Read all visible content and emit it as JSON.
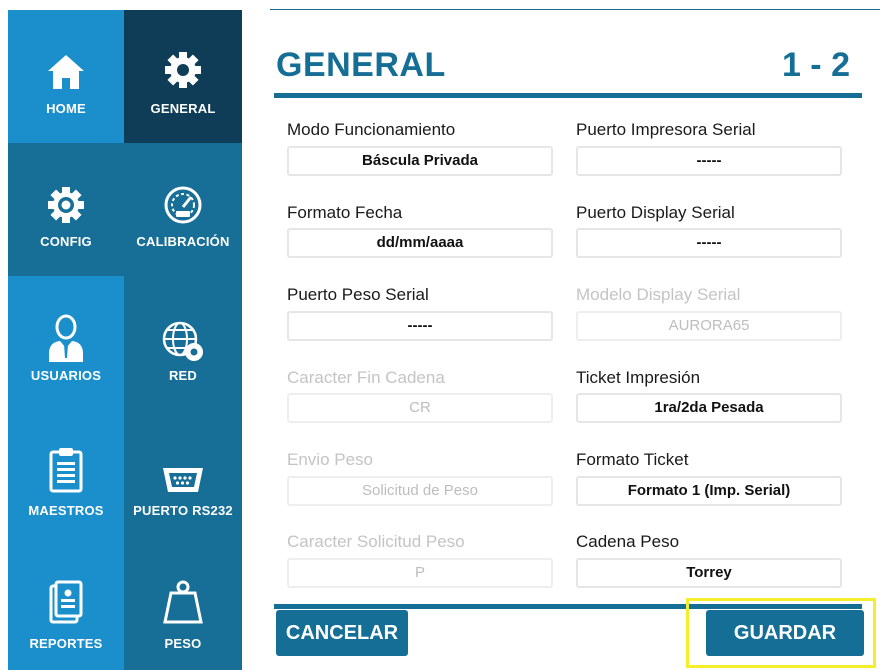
{
  "nav": {
    "col1": [
      {
        "label": "HOME",
        "icon": "home-icon",
        "bg": "#1a8fcc"
      },
      {
        "label": "CONFIG",
        "icon": "gear-icon",
        "bg": "#176e96"
      },
      {
        "label": "USUARIOS",
        "icon": "user-icon",
        "bg": "#1a8fcc"
      },
      {
        "label": "MAESTROS",
        "icon": "clipboard-icon",
        "bg": "#1a8fcc"
      },
      {
        "label": "REPORTES",
        "icon": "report-icon",
        "bg": "#1a8fcc"
      }
    ],
    "col2": [
      {
        "label": "GENERAL",
        "icon": "gear-icon",
        "bg": "#0f3d57"
      },
      {
        "label": "CALIBRACIÓN",
        "icon": "gauge-icon",
        "bg": "#176e96"
      },
      {
        "label": "RED",
        "icon": "globe-gear-icon",
        "bg": "#176e96"
      },
      {
        "label": "PUERTO RS232",
        "icon": "serial-port-icon",
        "bg": "#176e96"
      },
      {
        "label": "PESO",
        "icon": "weight-icon",
        "bg": "#176e96"
      }
    ]
  },
  "header": {
    "title": "GENERAL",
    "page": "1 - 2"
  },
  "fields": {
    "left": [
      {
        "label": "Modo Funcionamiento",
        "value": "Báscula Privada",
        "disabled": false
      },
      {
        "label": "Formato Fecha",
        "value": "dd/mm/aaaa",
        "disabled": false
      },
      {
        "label": "Puerto Peso Serial",
        "value": "-----",
        "disabled": false
      },
      {
        "label": "Caracter Fin Cadena",
        "value": "CR",
        "disabled": true
      },
      {
        "label": "Envio Peso",
        "value": "Solicitud de Peso",
        "disabled": true
      },
      {
        "label": "Caracter Solicitud Peso",
        "value": "P",
        "disabled": true
      }
    ],
    "right": [
      {
        "label": "Puerto Impresora Serial",
        "value": "-----",
        "disabled": false
      },
      {
        "label": "Puerto Display Serial",
        "value": "-----",
        "disabled": false
      },
      {
        "label": "Modelo Display Serial",
        "value": "AURORA65",
        "disabled": true
      },
      {
        "label": "Ticket Impresión",
        "value": "1ra/2da Pesada",
        "disabled": false
      },
      {
        "label": "Formato Ticket",
        "value": "Formato 1 (Imp. Serial)",
        "disabled": false
      },
      {
        "label": "Cadena Peso",
        "value": "Torrey",
        "disabled": false
      }
    ]
  },
  "buttons": {
    "cancel": "CANCELAR",
    "save": "GUARDAR"
  },
  "colors": {
    "accent": "#156e96",
    "highlight": "#f5ef2b"
  }
}
